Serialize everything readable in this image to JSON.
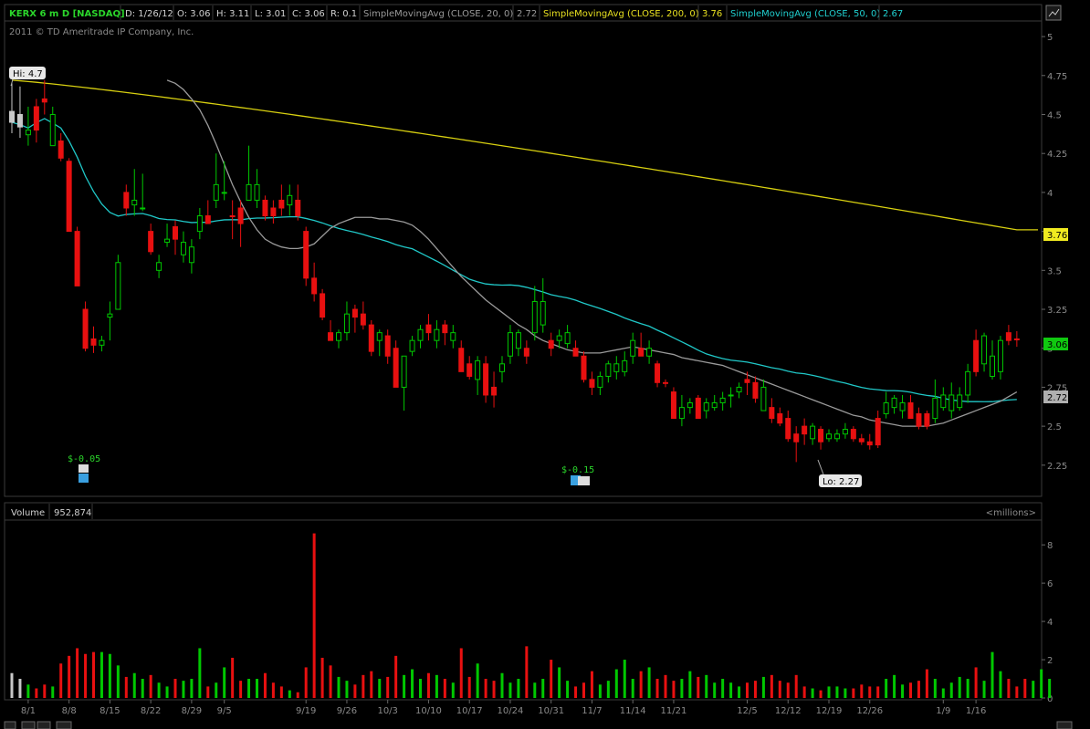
{
  "header": {
    "symbol": "KERX 6 m D [NASDAQ]",
    "date": "D: 1/26/12",
    "open": "O: 3.06",
    "high": "H: 3.11",
    "low": "L: 3.01",
    "close": "C: 3.06",
    "range": "R: 0.1",
    "sma20_label": "SimpleMovingAvg (CLOSE, 20, 0)",
    "sma20_value": "2.72",
    "sma200_label": "SimpleMovingAvg (CLOSE, 200, 0)",
    "sma200_value": "3.76",
    "sma50_label": "SimpleMovingAvg (CLOSE, 50, 0)",
    "sma50_value": "2.67"
  },
  "copyright": "2011 © TD Ameritrade IP Company, Inc.",
  "annotations": {
    "hi": "Hi: 4.7",
    "lo": "Lo: 2.27",
    "earn1": "$-0.05",
    "earn2": "$-0.15",
    "tag_sma200": "3.76",
    "tag_close": "3.06",
    "tag_sma20": "2.72"
  },
  "volume_panel": {
    "label": "Volume",
    "value": "952,874",
    "units": "<millions>"
  },
  "colors": {
    "up": "#00c800",
    "down": "#e81010",
    "neutral": "#c8c8c8",
    "sma20": "#9a9a9a",
    "sma50": "#20c8c8",
    "sma200": "#d8d010",
    "header_text": "#d0d0d0",
    "symbol": "#2bd62b"
  },
  "chart_data": {
    "type": "candlestick",
    "price_axis": {
      "ylim": [
        2.05,
        5.1
      ],
      "ticks": [
        "5",
        "4.75",
        "4.5",
        "4.25",
        "4",
        "3.75",
        "3.5",
        "3.25",
        "3",
        "2.75",
        "2.5",
        "2.25"
      ]
    },
    "volume_axis": {
      "ylim": [
        0,
        9.2
      ],
      "ticks": [
        "8",
        "6",
        "4",
        "2",
        "0"
      ]
    },
    "x_tick_labels": [
      {
        "label": "8/1",
        "index": 2
      },
      {
        "label": "8/8",
        "index": 7
      },
      {
        "label": "8/15",
        "index": 12
      },
      {
        "label": "8/22",
        "index": 17
      },
      {
        "label": "8/29",
        "index": 22
      },
      {
        "label": "9/5",
        "index": 26
      },
      {
        "label": "9/19",
        "index": 36
      },
      {
        "label": "9/26",
        "index": 41
      },
      {
        "label": "10/3",
        "index": 46
      },
      {
        "label": "10/10",
        "index": 51
      },
      {
        "label": "10/17",
        "index": 56
      },
      {
        "label": "10/24",
        "index": 61
      },
      {
        "label": "10/31",
        "index": 66
      },
      {
        "label": "11/7",
        "index": 71
      },
      {
        "label": "11/14",
        "index": 76
      },
      {
        "label": "11/21",
        "index": 81
      },
      {
        "label": "12/5",
        "index": 90
      },
      {
        "label": "12/12",
        "index": 95
      },
      {
        "label": "12/19",
        "index": 100
      },
      {
        "label": "12/26",
        "index": 105
      },
      {
        "label": "1/9",
        "index": 114
      },
      {
        "label": "1/16",
        "index": 118
      }
    ],
    "ohlc": [
      [
        4.52,
        4.7,
        4.38,
        4.45
      ],
      [
        4.5,
        4.68,
        4.35,
        4.42
      ],
      [
        4.4,
        4.55,
        4.3,
        4.37
      ],
      [
        4.4,
        4.6,
        4.32,
        4.55
      ],
      [
        4.6,
        4.72,
        4.5,
        4.58
      ],
      [
        4.5,
        4.55,
        4.3,
        4.3
      ],
      [
        4.33,
        4.38,
        4.2,
        4.22
      ],
      [
        4.2,
        4.22,
        3.75,
        3.75
      ],
      [
        3.75,
        3.78,
        3.4,
        3.4
      ],
      [
        3.25,
        3.3,
        2.98,
        3.0
      ],
      [
        3.06,
        3.14,
        2.97,
        3.02
      ],
      [
        3.02,
        3.08,
        2.98,
        3.05
      ],
      [
        3.2,
        3.3,
        3.05,
        3.22
      ],
      [
        3.25,
        3.6,
        3.25,
        3.55
      ],
      [
        3.9,
        4.05,
        3.85,
        4.0
      ],
      [
        3.95,
        4.15,
        3.85,
        3.92
      ],
      [
        3.9,
        4.12,
        3.88,
        3.9
      ],
      [
        3.75,
        3.8,
        3.6,
        3.62
      ],
      [
        3.55,
        3.6,
        3.45,
        3.5
      ],
      [
        3.68,
        3.8,
        3.65,
        3.7
      ],
      [
        3.7,
        3.82,
        3.6,
        3.78
      ],
      [
        3.68,
        3.75,
        3.55,
        3.6
      ],
      [
        3.55,
        3.7,
        3.48,
        3.65
      ],
      [
        3.75,
        3.9,
        3.7,
        3.85
      ],
      [
        3.85,
        3.95,
        3.8,
        3.8
      ],
      [
        3.95,
        4.25,
        3.9,
        4.05
      ],
      [
        4.0,
        4.2,
        3.95,
        4.0
      ],
      [
        3.85,
        3.95,
        3.7,
        3.85
      ],
      [
        3.9,
        3.95,
        3.65,
        3.8
      ],
      [
        3.95,
        4.3,
        3.95,
        4.05
      ],
      [
        4.05,
        4.15,
        3.9,
        3.95
      ],
      [
        3.95,
        3.98,
        3.82,
        3.85
      ],
      [
        3.85,
        3.95,
        3.8,
        3.9
      ],
      [
        3.9,
        4.05,
        3.85,
        3.95
      ],
      [
        3.98,
        4.05,
        3.85,
        3.92
      ],
      [
        3.95,
        4.05,
        3.82,
        3.85
      ],
      [
        3.75,
        3.78,
        3.4,
        3.45
      ],
      [
        3.45,
        3.55,
        3.3,
        3.35
      ],
      [
        3.35,
        3.38,
        3.18,
        3.2
      ],
      [
        3.1,
        3.18,
        3.05,
        3.05
      ],
      [
        3.05,
        3.12,
        3.0,
        3.1
      ],
      [
        3.1,
        3.3,
        3.05,
        3.22
      ],
      [
        3.2,
        3.28,
        3.1,
        3.25
      ],
      [
        3.22,
        3.3,
        3.12,
        3.15
      ],
      [
        3.15,
        3.18,
        2.95,
        2.98
      ],
      [
        3.05,
        3.12,
        2.95,
        3.1
      ],
      [
        3.08,
        3.12,
        2.9,
        2.95
      ],
      [
        3.0,
        3.05,
        2.75,
        2.75
      ],
      [
        2.75,
        2.95,
        2.6,
        2.95
      ],
      [
        2.98,
        3.08,
        2.95,
        3.05
      ],
      [
        3.05,
        3.15,
        3.0,
        3.12
      ],
      [
        3.15,
        3.22,
        3.05,
        3.1
      ],
      [
        3.12,
        3.18,
        3.0,
        3.05
      ],
      [
        3.1,
        3.18,
        3.02,
        3.15
      ],
      [
        3.1,
        3.15,
        3.0,
        3.05
      ],
      [
        3.0,
        3.05,
        2.85,
        2.85
      ],
      [
        2.9,
        2.95,
        2.8,
        2.82
      ],
      [
        2.8,
        2.95,
        2.7,
        2.92
      ],
      [
        2.9,
        2.95,
        2.65,
        2.7
      ],
      [
        2.7,
        2.85,
        2.62,
        2.75
      ],
      [
        2.85,
        2.95,
        2.78,
        2.9
      ],
      [
        2.95,
        3.15,
        2.9,
        3.1
      ],
      [
        3.1,
        3.12,
        2.95,
        3.0
      ],
      [
        2.95,
        3.05,
        2.9,
        3.0
      ],
      [
        3.1,
        3.4,
        3.05,
        3.3
      ],
      [
        3.3,
        3.45,
        3.1,
        3.15
      ],
      [
        3.05,
        3.1,
        2.95,
        3.0
      ],
      [
        3.05,
        3.12,
        3.0,
        3.08
      ],
      [
        3.1,
        3.15,
        3.0,
        3.03
      ],
      [
        3.0,
        3.05,
        2.95,
        2.95
      ],
      [
        2.95,
        2.98,
        2.78,
        2.8
      ],
      [
        2.8,
        2.85,
        2.7,
        2.75
      ],
      [
        2.75,
        2.85,
        2.7,
        2.82
      ],
      [
        2.82,
        2.92,
        2.78,
        2.9
      ],
      [
        2.9,
        2.95,
        2.8,
        2.85
      ],
      [
        2.85,
        2.98,
        2.82,
        2.92
      ],
      [
        2.95,
        3.1,
        2.9,
        3.05
      ],
      [
        3.0,
        3.1,
        2.95,
        2.95
      ],
      [
        2.95,
        3.05,
        2.9,
        3.0
      ],
      [
        2.9,
        2.92,
        2.75,
        2.78
      ],
      [
        2.78,
        2.8,
        2.75,
        2.78
      ],
      [
        2.72,
        2.75,
        2.55,
        2.55
      ],
      [
        2.55,
        2.7,
        2.5,
        2.62
      ],
      [
        2.62,
        2.68,
        2.58,
        2.65
      ],
      [
        2.68,
        2.7,
        2.55,
        2.55
      ],
      [
        2.6,
        2.68,
        2.55,
        2.65
      ],
      [
        2.62,
        2.7,
        2.6,
        2.65
      ],
      [
        2.68,
        2.72,
        2.6,
        2.65
      ],
      [
        2.7,
        2.75,
        2.62,
        2.7
      ],
      [
        2.72,
        2.78,
        2.68,
        2.75
      ],
      [
        2.8,
        2.85,
        2.7,
        2.78
      ],
      [
        2.78,
        2.82,
        2.65,
        2.68
      ],
      [
        2.75,
        2.8,
        2.6,
        2.6
      ],
      [
        2.62,
        2.68,
        2.52,
        2.55
      ],
      [
        2.58,
        2.62,
        2.5,
        2.52
      ],
      [
        2.55,
        2.6,
        2.4,
        2.42
      ],
      [
        2.45,
        2.5,
        2.27,
        2.4
      ],
      [
        2.45,
        2.55,
        2.38,
        2.5
      ],
      [
        2.5,
        2.52,
        2.38,
        2.42
      ],
      [
        2.4,
        2.5,
        2.35,
        2.48
      ],
      [
        2.45,
        2.48,
        2.4,
        2.42
      ],
      [
        2.42,
        2.48,
        2.4,
        2.45
      ],
      [
        2.45,
        2.52,
        2.42,
        2.48
      ],
      [
        2.48,
        2.5,
        2.4,
        2.42
      ],
      [
        2.42,
        2.45,
        2.38,
        2.4
      ],
      [
        2.4,
        2.45,
        2.35,
        2.38
      ],
      [
        2.38,
        2.6,
        2.36,
        2.55
      ],
      [
        2.58,
        2.72,
        2.55,
        2.65
      ],
      [
        2.62,
        2.7,
        2.58,
        2.68
      ],
      [
        2.65,
        2.7,
        2.55,
        2.6
      ],
      [
        2.65,
        2.7,
        2.55,
        2.55
      ],
      [
        2.58,
        2.62,
        2.48,
        2.5
      ],
      [
        2.5,
        2.6,
        2.48,
        2.58
      ],
      [
        2.55,
        2.8,
        2.52,
        2.68
      ],
      [
        2.62,
        2.75,
        2.6,
        2.7
      ],
      [
        2.7,
        2.78,
        2.55,
        2.6
      ],
      [
        2.62,
        2.75,
        2.6,
        2.7
      ],
      [
        2.7,
        2.9,
        2.65,
        2.85
      ],
      [
        2.85,
        3.12,
        2.82,
        3.05
      ],
      [
        3.08,
        3.1,
        2.85,
        2.9
      ],
      [
        2.95,
        3.05,
        2.8,
        2.82
      ],
      [
        2.85,
        3.08,
        2.8,
        3.05
      ],
      [
        3.1,
        3.15,
        3.02,
        3.05
      ],
      [
        3.06,
        3.11,
        3.01,
        3.06
      ]
    ],
    "directions": "nnudduddddduuuduuduuduuuduudduuddduddddduudddudduuudududdudduuuduuduuddduuuuududdduuduuuuudduddddduduuudddduuuddduuuuuduuuddduuuuudduuu",
    "volume_millions": [
      1.3,
      1.0,
      0.7,
      0.5,
      0.7,
      0.6,
      1.8,
      2.2,
      2.6,
      2.3,
      2.4,
      2.4,
      2.3,
      1.7,
      1.1,
      1.3,
      1.0,
      1.2,
      0.8,
      0.6,
      1.0,
      0.9,
      1.0,
      2.6,
      0.6,
      0.8,
      1.6,
      2.1,
      0.9,
      1.0,
      1.0,
      1.3,
      0.8,
      0.6,
      0.4,
      0.3,
      1.6,
      8.6,
      2.1,
      1.7,
      1.1,
      0.9,
      0.7,
      1.2,
      1.4,
      1.0,
      1.1,
      2.2,
      1.2,
      1.5,
      1.0,
      1.3,
      1.2,
      1.0,
      0.8,
      2.6,
      1.1,
      1.8,
      1.0,
      0.9,
      1.3,
      0.8,
      1.0,
      2.7,
      0.8,
      1.0,
      2.0,
      1.6,
      0.9,
      0.6,
      0.8,
      1.4,
      0.7,
      0.9,
      1.5,
      2.0,
      1.0,
      1.4,
      1.6,
      1.0,
      1.2,
      0.9,
      1.0,
      1.4,
      1.1,
      1.2,
      0.8,
      1.0,
      0.8,
      0.6,
      0.8,
      0.9,
      1.1,
      1.2,
      0.9,
      0.8,
      1.2,
      0.6,
      0.5,
      0.4,
      0.6,
      0.6,
      0.5,
      0.5,
      0.7,
      0.6,
      0.6,
      1.0,
      1.2,
      0.7,
      0.8,
      0.9,
      1.5,
      1.0,
      0.5,
      0.8,
      1.1,
      1.0,
      1.6,
      0.9,
      2.4,
      1.4,
      1.0,
      0.6,
      1.0,
      0.9,
      1.5,
      1.0
    ],
    "sma20": [
      4.72,
      4.7,
      4.66,
      4.6,
      4.53,
      4.43,
      4.31,
      4.18,
      4.05,
      3.94,
      3.84,
      3.76,
      3.7,
      3.67,
      3.65,
      3.64,
      3.64,
      3.65,
      3.67,
      3.72,
      3.77,
      3.8,
      3.82,
      3.84,
      3.84,
      3.84,
      3.83,
      3.83,
      3.82,
      3.81,
      3.79,
      3.75,
      3.7,
      3.64,
      3.58,
      3.52,
      3.46,
      3.41,
      3.36,
      3.31,
      3.27,
      3.23,
      3.19,
      3.15,
      3.12,
      3.08,
      3.05,
      3.03,
      3.01,
      2.99,
      2.98,
      2.97,
      2.97,
      2.97,
      2.98,
      2.99,
      3.0,
      3.01,
      3.0,
      2.99,
      2.98,
      2.97,
      2.96,
      2.94,
      2.93,
      2.92,
      2.91,
      2.9,
      2.89,
      2.87,
      2.85,
      2.83,
      2.81,
      2.79,
      2.77,
      2.75,
      2.73,
      2.71,
      2.69,
      2.67,
      2.65,
      2.63,
      2.61,
      2.59,
      2.57,
      2.56,
      2.54,
      2.53,
      2.52,
      2.51,
      2.5,
      2.5,
      2.5,
      2.5,
      2.51,
      2.52,
      2.54,
      2.56,
      2.58,
      2.6,
      2.62,
      2.64,
      2.66,
      2.69,
      2.72
    ]
  }
}
